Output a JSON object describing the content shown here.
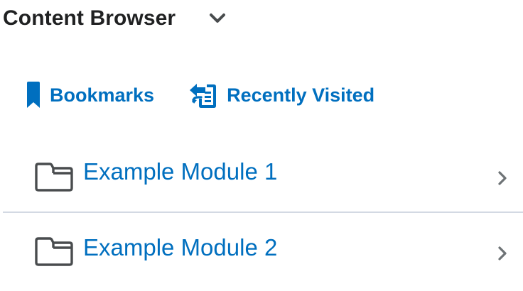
{
  "header": {
    "title": "Content Browser",
    "toggle_icon": "chevron-down-icon"
  },
  "quick_links": [
    {
      "label": "Bookmarks",
      "icon": "bookmark-icon"
    },
    {
      "label": "Recently Visited",
      "icon": "recently-visited-icon"
    }
  ],
  "modules": [
    {
      "title": "Example Module 1",
      "icon": "folder-icon",
      "action_icon": "chevron-right-icon"
    },
    {
      "title": "Example Module 2",
      "icon": "folder-icon",
      "action_icon": "chevron-right-icon"
    }
  ],
  "colors": {
    "link": "#006fbf",
    "heading": "#202122",
    "icon_gray": "#494c4e",
    "divider": "#d3d9e3"
  }
}
